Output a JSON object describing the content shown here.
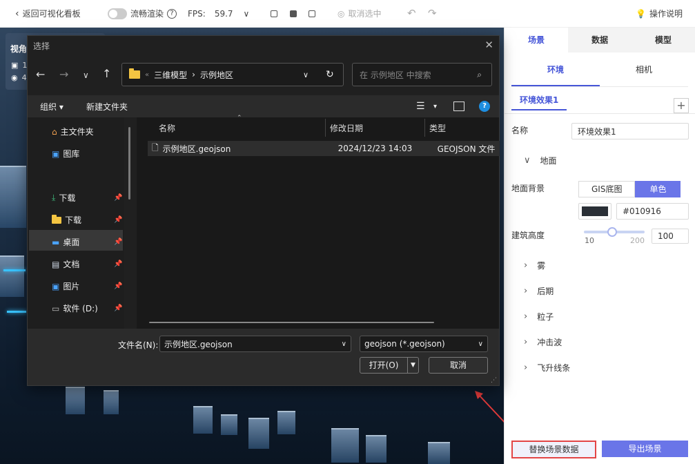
{
  "toolbar": {
    "back_label": "返回可视化看板",
    "smooth_label": "流畅渲染",
    "fps_label": "FPS:",
    "fps_value": "59.7",
    "cancel_select_label": "取消选中",
    "help_label": "操作说明"
  },
  "camera_card": {
    "title": "视角",
    "line1": "1",
    "line2": "4"
  },
  "panel": {
    "tabs": [
      "场景",
      "数据",
      "模型"
    ],
    "subtabs": [
      "环境",
      "相机"
    ],
    "effect_tab": "环境效果1",
    "name_label": "名称",
    "name_value": "环境效果1",
    "ground_section": "地面",
    "ground_bg_label": "地面背景",
    "ground_options": [
      "GIS底图",
      "单色"
    ],
    "color_hex": "#010916",
    "color_swatch": "#2a2f36",
    "building_height_label": "建筑高度",
    "slider_min": "10",
    "slider_max": "200",
    "slider_value": "100",
    "sections": [
      "雾",
      "后期",
      "粒子",
      "冲击波",
      "飞升线条"
    ],
    "replace_button": "替换场景数据",
    "export_button": "导出场景"
  },
  "dialog": {
    "title": "选择",
    "path": [
      "三维模型",
      "示例地区"
    ],
    "search_placeholder": "在 示例地区 中搜索",
    "organize": "组织",
    "new_folder": "新建文件夹",
    "nav_items": [
      {
        "label": "主文件夹"
      },
      {
        "label": "图库"
      },
      {
        "label": "下载"
      },
      {
        "label": "下载"
      },
      {
        "label": "桌面"
      },
      {
        "label": "文档"
      },
      {
        "label": "图片"
      },
      {
        "label": "软件 (D:)"
      }
    ],
    "columns": [
      "名称",
      "修改日期",
      "类型"
    ],
    "files": [
      {
        "name": "示例地区.geojson",
        "date": "2024/12/23 14:03",
        "type": "GEOJSON 文件"
      }
    ],
    "filename_label": "文件名(N):",
    "filename_value": "示例地区.geojson",
    "filter_value": "geojson (*.geojson)",
    "open_button": "打开(O)",
    "cancel_button": "取消"
  }
}
